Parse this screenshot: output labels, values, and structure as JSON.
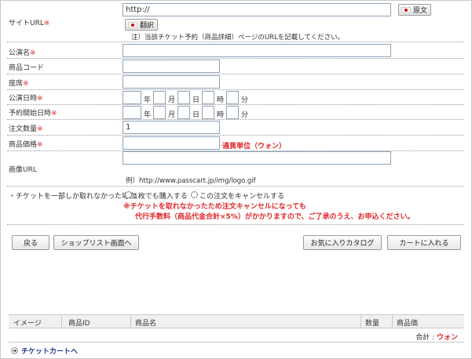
{
  "site_url": {
    "label": "サイトURL",
    "req": "※",
    "value": "http://",
    "original_label": "原文",
    "translate_label": "翻訳",
    "note": "注）当該チケット予約（商品詳細）ページのURLを記載してください。"
  },
  "performance_name": {
    "label": "公演名",
    "req": "※",
    "value": ""
  },
  "product_code": {
    "label": "商品コード",
    "value": ""
  },
  "seat": {
    "label": "座席",
    "req": "※",
    "value": ""
  },
  "performance_date": {
    "label": "公演日時",
    "req": "※",
    "units": [
      "年",
      "月",
      "日",
      "時",
      "分"
    ]
  },
  "reservation_start": {
    "label": "予約開始日時",
    "req": "※",
    "units": [
      "年",
      "月",
      "日",
      "時",
      "分"
    ]
  },
  "order_quantity": {
    "label": "注文数量",
    "req": "※",
    "value": "1"
  },
  "product_price": {
    "label": "商品価格",
    "req": "※",
    "value": "",
    "currency_note": "通貨単位（ウォン）"
  },
  "image_url": {
    "label": "画像URL",
    "value": "",
    "example": "例）http://www.passcart.jp/img/logo.gif"
  },
  "partial": {
    "label": "・チケットを一部しか取れなかった場合",
    "option1": "1枚でも購入する",
    "option2": "この注文をキャンセルする",
    "warn1": "※チケットを取れなかったため注文キャンセルになっても",
    "warn2": "代行手数料（商品代金合計×5%）がかかりますので、ご了承のうえ、お申込ください。"
  },
  "buttons": {
    "back": "戻る",
    "shoplist": "ショップリスト画面へ",
    "favorite": "お気に入りカタログ",
    "add_cart": "カートに入れる"
  },
  "cart": {
    "columns": [
      "イメージ",
      "商品ID",
      "商品名",
      "数量",
      "商品価"
    ],
    "total_label": "合計 :",
    "total_currency": "ウォン",
    "link": "チケットカートへ"
  },
  "colors": {
    "required": "#e0282a",
    "link": "#1a3d8f",
    "input_border": "#8fa3b8"
  }
}
